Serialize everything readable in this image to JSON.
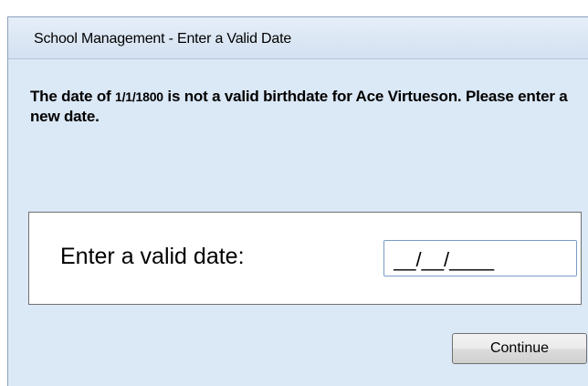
{
  "window": {
    "title": "School Management - Enter a Valid Date"
  },
  "message": {
    "prefix": "The date of ",
    "invalid_date": "1/1/1800",
    "suffix": " is not a valid birthdate for Ace Virtueson. Please enter a new date."
  },
  "date_entry": {
    "label": "Enter a valid date:",
    "value": "__/__/____"
  },
  "buttons": {
    "continue_label": "Continue"
  },
  "colors": {
    "window_background": "#dbe8f6",
    "titlebar": "#d3e1f1",
    "panel_background": "#ffffff"
  }
}
